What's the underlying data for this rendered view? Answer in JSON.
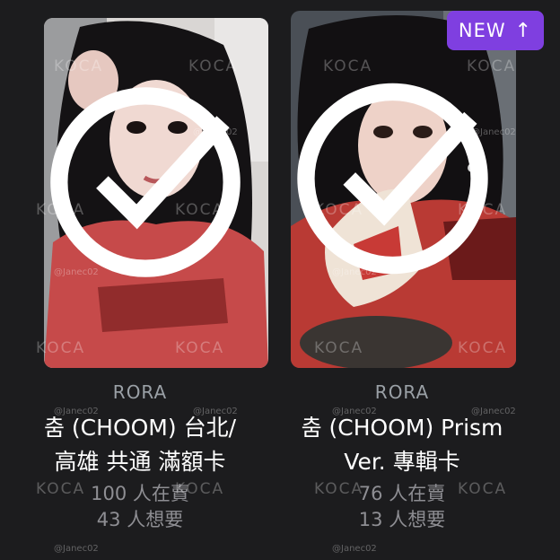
{
  "cards": [
    {
      "artist": "RORA",
      "title_line1": "춤 (CHOOM) 台北/",
      "title_line2": "高雄 共通 滿額卡",
      "selling": "100 人在賣",
      "wanting": "43 人想要"
    },
    {
      "artist": "RORA",
      "title_line1": "춤 (CHOOM) Prism",
      "title_line2": "Ver. 專輯卡",
      "selling": "76 人在賣",
      "wanting": "13 人想要",
      "badge": "NEW"
    }
  ],
  "watermark": {
    "brand": "KOCA",
    "user": "@Janec02"
  },
  "colors": {
    "background": "#1c1c1e",
    "badge": "#7f3fe0",
    "artist_text": "#9aa0a6",
    "stat_text": "#8e8e93"
  }
}
